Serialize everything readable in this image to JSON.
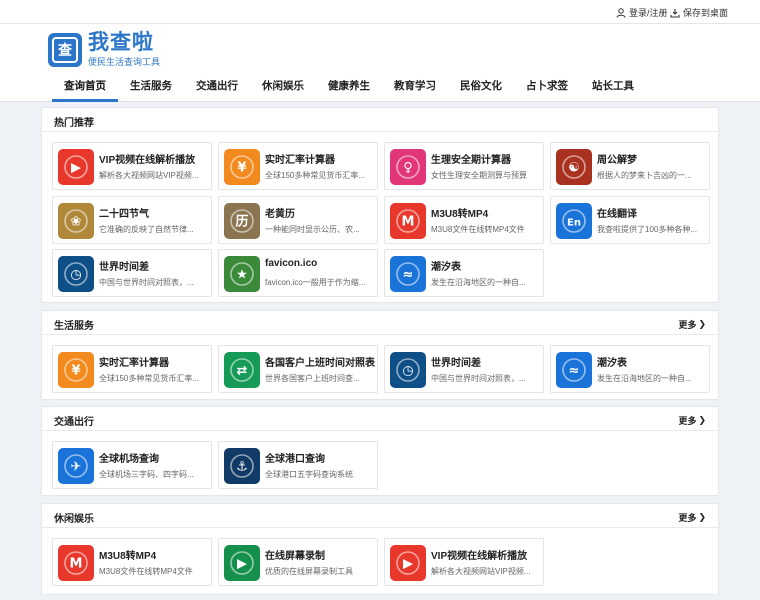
{
  "topbar": {
    "login": "登录/注册",
    "save": "保存到桌面"
  },
  "logo": {
    "mark": "查",
    "title": "我查啦",
    "subtitle": "便民生活查询工具"
  },
  "nav": [
    "查询首页",
    "生活服务",
    "交通出行",
    "休闲娱乐",
    "健康养生",
    "教育学习",
    "民俗文化",
    "占卜求签",
    "站长工具"
  ],
  "more_label": "更多",
  "sections": {
    "hot": {
      "title": "热门推荐",
      "items": [
        {
          "title": "VIP视频在线解析播放",
          "desc": "解析各大视频网站VIP视频..."
        },
        {
          "title": "实时汇率计算器",
          "desc": "全球150多种常见货币汇率..."
        },
        {
          "title": "生理安全期计算器",
          "desc": "女性生理安全期测算与预算"
        },
        {
          "title": "周公解梦",
          "desc": "根据人的梦来卜吉凶的一..."
        },
        {
          "title": "二十四节气",
          "desc": "它准确的反映了自然节律..."
        },
        {
          "title": "老黄历",
          "desc": "一种能同时显示公历、农..."
        },
        {
          "title": "M3U8转MP4",
          "desc": "M3U8文件在线转MP4文件"
        },
        {
          "title": "在线翻译",
          "desc": "我查啦提供了100多种各种..."
        },
        {
          "title": "世界时间差",
          "desc": "中国与世界时间对照表，..."
        },
        {
          "title": "favicon.ico",
          "desc": "favicon.ico一般用于作为缩..."
        },
        {
          "title": "潮汐表",
          "desc": "发生在沿海地区的一种自..."
        }
      ]
    },
    "life": {
      "title": "生活服务",
      "items": [
        {
          "title": "实时汇率计算器",
          "desc": "全球150多种常见货币汇率..."
        },
        {
          "title": "各国客户上班时间对照表",
          "desc": "世界各国客户上班时间查..."
        },
        {
          "title": "世界时间差",
          "desc": "中国与世界时间对照表，..."
        },
        {
          "title": "潮汐表",
          "desc": "发生在沿海地区的一种自..."
        }
      ]
    },
    "traffic": {
      "title": "交通出行",
      "items": [
        {
          "title": "全球机场查询",
          "desc": "全球机场三字码、四字码..."
        },
        {
          "title": "全球港口查询",
          "desc": "全球港口五字码查询系统"
        }
      ]
    },
    "leisure": {
      "title": "休闲娱乐",
      "items": [
        {
          "title": "M3U8转MP4",
          "desc": "M3U8文件在线转MP4文件"
        },
        {
          "title": "在线屏幕录制",
          "desc": "优质的在线屏幕录制工具"
        },
        {
          "title": "VIP视频在线解析播放",
          "desc": "解析各大视频网站VIP视频..."
        }
      ]
    }
  },
  "icons": {
    "video-icon": {
      "color": "#e8382b",
      "char": "▶"
    },
    "exchange-icon": {
      "color": "#f28a1e",
      "char": "¥"
    },
    "period-icon": {
      "color": "#e2367a",
      "char": "♀"
    },
    "dream-icon": {
      "color": "#a8321f",
      "char": "☯"
    },
    "solar-term-icon": {
      "color": "#b0883a",
      "char": "❀"
    },
    "almanac-icon": {
      "color": "#8a7550",
      "char": "历"
    },
    "m3u8-icon": {
      "color": "#e8382b",
      "char": "M"
    },
    "translate-icon": {
      "color": "#1a73d9",
      "char": "En"
    },
    "world-time-icon": {
      "color": "#0d4f86",
      "char": "◷"
    },
    "favicon-icon": {
      "color": "#3a8a3a",
      "char": "★"
    },
    "tide-icon": {
      "color": "#1a73d9",
      "char": "≈"
    },
    "office-time-icon": {
      "color": "#159a58",
      "char": "⇄"
    },
    "airport-icon": {
      "color": "#1a73d9",
      "char": "✈"
    },
    "port-icon": {
      "color": "#123a66",
      "char": "⚓"
    },
    "screen-record-icon": {
      "color": "#15904c",
      "char": "▶"
    }
  }
}
